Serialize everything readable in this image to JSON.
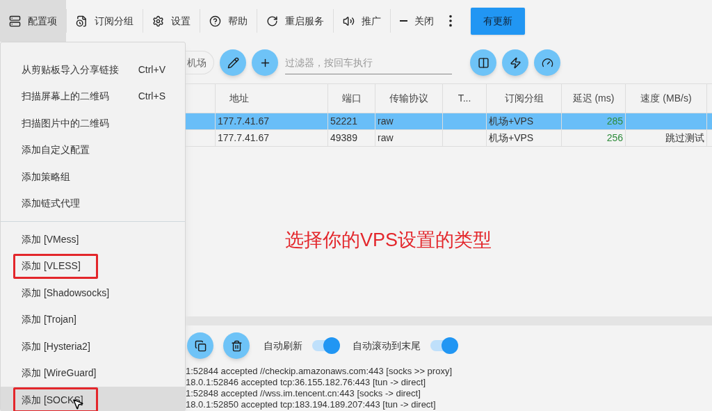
{
  "toolbar": {
    "items": [
      {
        "label": "配置项",
        "selected": true
      },
      {
        "label": "订阅分组",
        "selected": false
      },
      {
        "label": "设置",
        "selected": false
      },
      {
        "label": "帮助",
        "selected": false
      },
      {
        "label": "重启服务",
        "selected": false
      },
      {
        "label": "推广",
        "selected": false
      },
      {
        "label": "关闭",
        "selected": false
      }
    ],
    "update_button": "有更新"
  },
  "menu": {
    "groups": [
      [
        {
          "label": "从剪贴板导入分享链接",
          "shortcut": "Ctrl+V",
          "highlighted": false,
          "selected": false
        },
        {
          "label": "扫描屏幕上的二维码",
          "shortcut": "Ctrl+S",
          "highlighted": false,
          "selected": false
        },
        {
          "label": "扫描图片中的二维码",
          "highlighted": false,
          "selected": false
        },
        {
          "label": "添加自定义配置",
          "highlighted": false,
          "selected": false
        },
        {
          "label": "添加策略组",
          "highlighted": false,
          "selected": false
        },
        {
          "label": "添加链式代理",
          "highlighted": false,
          "selected": false
        }
      ],
      [
        {
          "label": "添加 [VMess]",
          "highlighted": false,
          "selected": false
        },
        {
          "label": "添加 [VLESS]",
          "highlighted": true,
          "selected": false
        },
        {
          "label": "添加 [Shadowsocks]",
          "highlighted": false,
          "selected": false
        },
        {
          "label": "添加 [Trojan]",
          "highlighted": false,
          "selected": false
        },
        {
          "label": "添加 [Hysteria2]",
          "highlighted": false,
          "selected": false
        },
        {
          "label": "添加 [WireGuard]",
          "highlighted": false,
          "selected": false
        },
        {
          "label": "添加 [SOCKS]",
          "highlighted": true,
          "selected": true
        }
      ]
    ]
  },
  "filter_bar": {
    "chip": "机场",
    "placeholder": "过滤器，按回车执行"
  },
  "table": {
    "columns": [
      "地址",
      "端口",
      "传输协议",
      "T...",
      "订阅分组",
      "延迟 (ms)",
      "速度 (MB/s)"
    ],
    "rows": [
      {
        "cells": [
          "177.7.41.67",
          "52221",
          "raw",
          "",
          "机场+VPS",
          "285",
          ""
        ],
        "selected": true
      },
      {
        "cells": [
          "177.7.41.67",
          "49389",
          "raw",
          "",
          "机场+VPS",
          "256",
          "跳过测试"
        ],
        "selected": false
      }
    ]
  },
  "annotation": "选择你的VPS设置的类型",
  "log_panel": {
    "toggles": [
      {
        "label": "自动刷新",
        "on": true
      },
      {
        "label": "自动滚动到末尾",
        "on": true
      }
    ],
    "lines": [
      "1:52844 accepted //checkip.amazonaws.com:443 [socks >> proxy]",
      "18.0.1:52846 accepted tcp:36.155.182.76:443 [tun -> direct]",
      "1:52848 accepted //wss.im.tencent.cn:443 [socks -> direct]",
      "18.0.1:52850 accepted tcp:183.194.189.207:443 [tun -> direct]"
    ]
  }
}
